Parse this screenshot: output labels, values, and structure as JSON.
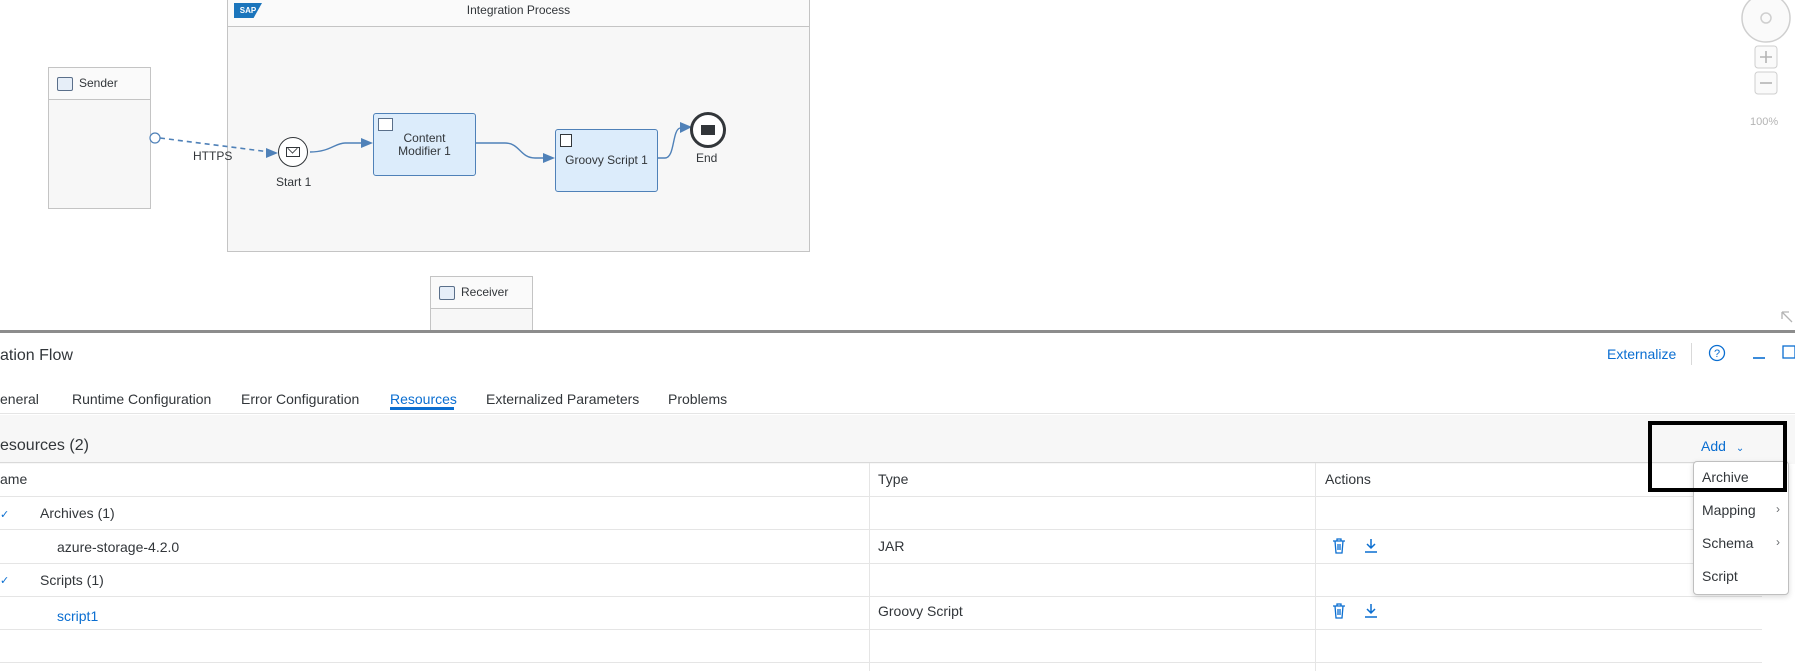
{
  "canvas": {
    "integration_process_title": "Integration Process",
    "sap_logo_text": "SAP",
    "sender_label": "Sender",
    "receiver_label": "Receiver",
    "https_label": "HTTPS",
    "start_label": "Start 1",
    "content_modifier_label": "Content Modifier 1",
    "groovy_script_label": "Groovy Script 1",
    "end_label": "End",
    "zoom_level": "100%"
  },
  "panel": {
    "title": "ation Flow",
    "externalize_label": "Externalize",
    "tabs": [
      {
        "label": "eneral"
      },
      {
        "label": "Runtime Configuration"
      },
      {
        "label": "Error Configuration"
      },
      {
        "label": "Resources"
      },
      {
        "label": "Externalized Parameters"
      },
      {
        "label": "Problems"
      }
    ],
    "active_tab": "Resources"
  },
  "resources": {
    "title": "esources (2)",
    "add_label": "Add",
    "columns": {
      "name": "ame",
      "type": "Type",
      "actions": "Actions"
    },
    "groups": [
      {
        "label": "Archives (1)",
        "items": [
          {
            "name": "azure-storage-4.2.0",
            "type": "JAR"
          }
        ]
      },
      {
        "label": "Scripts (1)",
        "items": [
          {
            "name": "script1",
            "type": "Groovy Script"
          }
        ]
      }
    ]
  },
  "add_menu": {
    "items": [
      {
        "label": "Archive"
      },
      {
        "label": "Mapping",
        "submenu": true
      },
      {
        "label": "Schema",
        "submenu": true
      },
      {
        "label": "Script"
      }
    ]
  },
  "colors": {
    "accent": "#0a6ed1",
    "step_fill": "#dcecfb",
    "step_border": "#4f81b8"
  }
}
